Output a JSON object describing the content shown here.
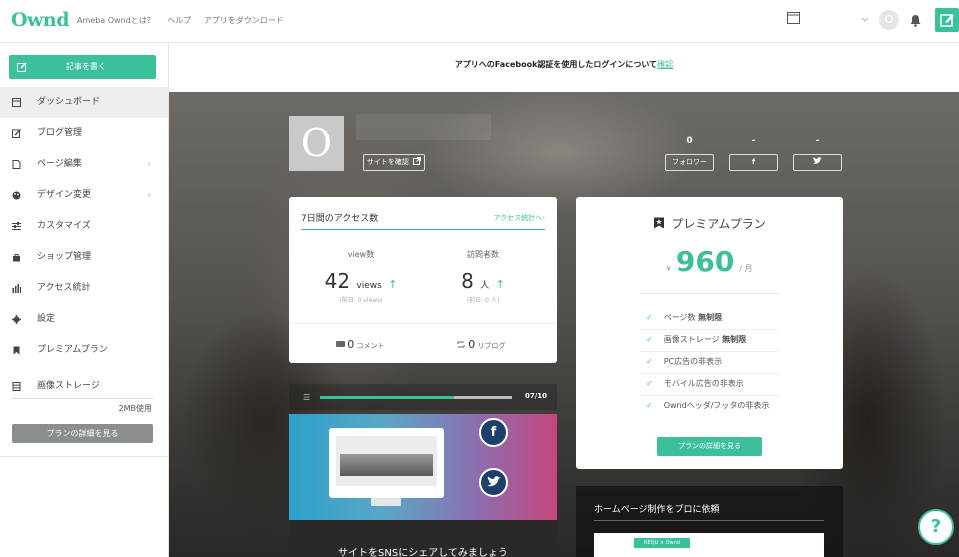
{
  "brand": {
    "logo": "Ownd",
    "accent": "#3cbf9b"
  },
  "topnav": {
    "items": [
      "Ameba Owndとは？",
      "ヘルプ",
      "アプリをダウンロード"
    ],
    "avatar_letter": "O"
  },
  "sidebar": {
    "write_button": "記事を書く",
    "items": [
      {
        "label": "ダッシュボード",
        "icon": "dashboard-icon"
      },
      {
        "label": "ブログ管理",
        "icon": "edit-icon"
      },
      {
        "label": "ページ編集",
        "icon": "page-icon"
      },
      {
        "label": "デザイン変更",
        "icon": "palette-icon"
      },
      {
        "label": "カスタマイズ",
        "icon": "sliders-icon"
      },
      {
        "label": "ショップ管理",
        "icon": "shop-icon"
      },
      {
        "label": "アクセス統計",
        "icon": "bar-chart-icon"
      },
      {
        "label": "設定",
        "icon": "gear-icon"
      },
      {
        "label": "プレミアムプラン",
        "icon": "bookmark-icon"
      },
      {
        "label": "画像ストレージ",
        "icon": "storage-icon"
      }
    ],
    "storage_used": "2MB使用",
    "storage_button": "プランの詳細を見る"
  },
  "notice": {
    "text": "アプリへのFacebook認証を使用したログインについて",
    "link": "確認"
  },
  "profile": {
    "letter": "O",
    "site_button": "サイトを確認",
    "followers_count": "0",
    "facebook_count": "-",
    "twitter_count": "-",
    "follow_label": "フォロワー",
    "facebook_label": "f",
    "twitter_label": "t"
  },
  "access": {
    "title": "7日間のアクセス数",
    "link": "アクセス統計へ",
    "views_label": "view数",
    "views_value": "42",
    "views_unit": "views",
    "views_prev": "(前日: 0 views)",
    "visitors_label": "訪問者数",
    "visitors_value": "8",
    "visitors_unit": "人",
    "visitors_prev": "(前日: 0 人)",
    "comments_value": "0",
    "comments_label": "コメント",
    "reblogs_value": "0",
    "reblogs_label": "リブログ"
  },
  "premium": {
    "title": "プレミアムプラン",
    "yen": "¥",
    "price": "960",
    "per": "/ 月",
    "features": [
      {
        "text": "ページ数",
        "bold": "無制限"
      },
      {
        "text": "画像ストレージ",
        "bold": "無制限"
      },
      {
        "text": "PC広告の非表示",
        "bold": ""
      },
      {
        "text": "モバイル広告の非表示",
        "bold": ""
      },
      {
        "text": "Owndヘッダ/フッタの非表示",
        "bold": ""
      }
    ],
    "button": "プランの詳細を見る"
  },
  "tutorial": {
    "progress": 0.7,
    "count": "07/10",
    "caption": "サイトをSNSにシェアしてみましょう"
  },
  "homepage": {
    "title": "ホームページ制作をプロに依頼",
    "badge": "REQU × Ownd"
  },
  "help_label": "?"
}
